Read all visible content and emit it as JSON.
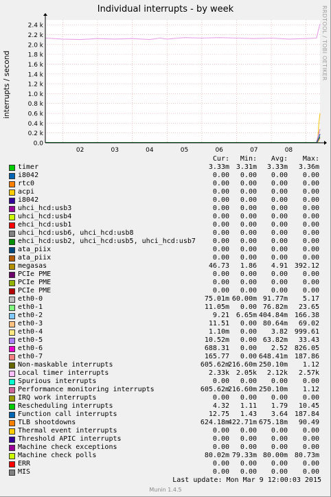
{
  "chart_data": {
    "type": "line",
    "title": "Individual interrupts - by week",
    "ylabel": "interrupts / second",
    "vendor": "RRDTOOL / TOBI OETIKER",
    "ylim": [
      0,
      2.5
    ],
    "yticks": [
      {
        "v": 0.0,
        "label": "0.0"
      },
      {
        "v": 0.2,
        "label": "0.2 k"
      },
      {
        "v": 0.4,
        "label": "0.4 k"
      },
      {
        "v": 0.6,
        "label": "0.6 k"
      },
      {
        "v": 0.8,
        "label": "0.8 k"
      },
      {
        "v": 1.0,
        "label": "1.0 k"
      },
      {
        "v": 1.2,
        "label": "1.2 k"
      },
      {
        "v": 1.4,
        "label": "1.4 k"
      },
      {
        "v": 1.6,
        "label": "1.6 k"
      },
      {
        "v": 1.8,
        "label": "1.8 k"
      },
      {
        "v": 2.0,
        "label": "2.0 k"
      },
      {
        "v": 2.2,
        "label": "2.2 k"
      },
      {
        "v": 2.4,
        "label": "2.4 k"
      }
    ],
    "xlim": [
      1,
      8.9
    ],
    "xticks": [
      {
        "v": 2,
        "label": "02"
      },
      {
        "v": 3,
        "label": "03"
      },
      {
        "v": 4,
        "label": "04"
      },
      {
        "v": 5,
        "label": "05"
      },
      {
        "v": 6,
        "label": "06"
      },
      {
        "v": 7,
        "label": "07"
      },
      {
        "v": 8,
        "label": "08"
      }
    ],
    "grid": true,
    "series": [
      {
        "name": "Local timer interrupts",
        "color": "#e7a0e7",
        "x": [
          1,
          1.5,
          2,
          2.5,
          3,
          3.5,
          4,
          4.3,
          4.5,
          5,
          5.5,
          6,
          6.5,
          7,
          7.5,
          8,
          8.5,
          8.8,
          8.85,
          8.9
        ],
        "y": [
          2.13,
          2.11,
          2.1,
          2.12,
          2.11,
          2.12,
          2.1,
          2.13,
          2.11,
          2.14,
          2.13,
          2.14,
          2.13,
          2.12,
          2.13,
          2.11,
          2.12,
          2.13,
          2.28,
          2.42
        ]
      },
      {
        "name": "acpi",
        "color": "#f2c618",
        "x": [
          1,
          8.8,
          8.84,
          8.87,
          8.9
        ],
        "y": [
          0,
          0,
          0.12,
          0.42,
          0.6
        ]
      },
      {
        "name": "Rescheduling interrupts",
        "color": "#1a9e1a",
        "x": [
          1,
          8.8,
          8.86,
          8.9
        ],
        "y": [
          0.005,
          0.005,
          0.08,
          0.12
        ]
      },
      {
        "name": "eth0-6",
        "color": "#d47ab8",
        "x": [
          1,
          8.8,
          8.87,
          8.9
        ],
        "y": [
          0,
          0,
          0.2,
          0.28
        ]
      },
      {
        "name": "megasas",
        "color": "#cc7a1a",
        "x": [
          1,
          8.8,
          8.86,
          8.9
        ],
        "y": [
          0,
          0,
          0.04,
          0.1
        ]
      },
      {
        "name": "timer",
        "color": "#00cc00",
        "x": [
          1,
          8.9
        ],
        "y": [
          0.003,
          0.003
        ]
      },
      {
        "name": "Function call interrupts",
        "color": "#0b4a9a",
        "x": [
          1,
          8.8,
          8.86,
          8.9
        ],
        "y": [
          0.002,
          0.002,
          0.09,
          0.18
        ]
      },
      {
        "name": "Machine check polls",
        "color": "#000066",
        "x": [
          1,
          8.9
        ],
        "y": [
          0.0,
          0.0
        ]
      }
    ]
  },
  "legend": {
    "headers": [
      "Cur:",
      "Min:",
      "Avg:",
      "Max:"
    ],
    "rows": [
      {
        "name": "timer",
        "color": "#00cc00",
        "cur": "3.33m",
        "min": "3.31m",
        "avg": "3.33m",
        "max": "3.36m"
      },
      {
        "name": "i8042",
        "color": "#0066b3",
        "cur": "0.00",
        "min": "0.00",
        "avg": "0.00",
        "max": "0.00"
      },
      {
        "name": "rtc0",
        "color": "#ff8000",
        "cur": "0.00",
        "min": "0.00",
        "avg": "0.00",
        "max": "0.00"
      },
      {
        "name": "acpi",
        "color": "#ffcc00",
        "cur": "0.00",
        "min": "0.00",
        "avg": "0.00",
        "max": "0.00"
      },
      {
        "name": "i8042",
        "color": "#330099",
        "cur": "0.00",
        "min": "0.00",
        "avg": "0.00",
        "max": "0.00"
      },
      {
        "name": "uhci_hcd:usb3",
        "color": "#990099",
        "cur": "0.00",
        "min": "0.00",
        "avg": "0.00",
        "max": "0.00"
      },
      {
        "name": "uhci_hcd:usb4",
        "color": "#ccff00",
        "cur": "0.00",
        "min": "0.00",
        "avg": "0.00",
        "max": "0.00"
      },
      {
        "name": "ehci_hcd:usb1",
        "color": "#ff0000",
        "cur": "0.00",
        "min": "0.00",
        "avg": "0.00",
        "max": "0.00"
      },
      {
        "name": "uhci_hcd:usb6, uhci_hcd:usb8",
        "color": "#808080",
        "cur": "0.00",
        "min": "0.00",
        "avg": "0.00",
        "max": "0.00"
      },
      {
        "name": "ehci_hcd:usb2, uhci_hcd:usb5, uhci_hcd:usb7",
        "color": "#008f00",
        "cur": "0.00",
        "min": "0.00",
        "avg": "0.00",
        "max": "0.00"
      },
      {
        "name": "ata_piix",
        "color": "#00487d",
        "cur": "0.00",
        "min": "0.00",
        "avg": "0.00",
        "max": "0.00"
      },
      {
        "name": "ata_piix",
        "color": "#b35a00",
        "cur": "0.00",
        "min": "0.00",
        "avg": "0.00",
        "max": "0.00"
      },
      {
        "name": "megasas",
        "color": "#b38f00",
        "cur": "46.73",
        "min": "1.86",
        "avg": "4.91",
        "max": "392.12"
      },
      {
        "name": "PCIe PME",
        "color": "#6b006b",
        "cur": "0.00",
        "min": "0.00",
        "avg": "0.00",
        "max": "0.00"
      },
      {
        "name": "PCIe PME",
        "color": "#8fb300",
        "cur": "0.00",
        "min": "0.00",
        "avg": "0.00",
        "max": "0.00"
      },
      {
        "name": "PCIe PME",
        "color": "#b30000",
        "cur": "0.00",
        "min": "0.00",
        "avg": "0.00",
        "max": "0.00"
      },
      {
        "name": "eth0-0",
        "color": "#bebebe",
        "cur": "75.01m",
        "min": "60.00m",
        "avg": "91.77m",
        "max": "5.17"
      },
      {
        "name": "eth0-1",
        "color": "#80ff80",
        "cur": "11.05m",
        "min": "0.00",
        "avg": "76.82m",
        "max": "23.65"
      },
      {
        "name": "eth0-2",
        "color": "#80c9ff",
        "cur": "9.21",
        "min": "6.65m",
        "avg": "404.84m",
        "max": "166.38"
      },
      {
        "name": "eth0-3",
        "color": "#ffc080",
        "cur": "11.51",
        "min": "0.00",
        "avg": "80.64m",
        "max": "69.02"
      },
      {
        "name": "eth0-4",
        "color": "#ffe680",
        "cur": "1.10m",
        "min": "0.00",
        "avg": "3.82",
        "max": "999.61"
      },
      {
        "name": "eth0-5",
        "color": "#aa80ff",
        "cur": "10.52m",
        "min": "0.00",
        "avg": "63.82m",
        "max": "33.43"
      },
      {
        "name": "eth0-6",
        "color": "#ee00cc",
        "cur": "688.31",
        "min": "0.00",
        "avg": "2.52",
        "max": "826.05"
      },
      {
        "name": "eth0-7",
        "color": "#ff8080",
        "cur": "165.77",
        "min": "0.00",
        "avg": "648.41m",
        "max": "187.86"
      },
      {
        "name": "Non-maskable interrupts",
        "color": "#666600",
        "cur": "605.62m",
        "min": "216.60m",
        "avg": "250.10m",
        "max": "1.12"
      },
      {
        "name": "Local timer interrupts",
        "color": "#ffbfff",
        "cur": "2.33k",
        "min": "2.05k",
        "avg": "2.12k",
        "max": "2.57k"
      },
      {
        "name": "Spurious interrupts",
        "color": "#00ffcc",
        "cur": "0.00",
        "min": "0.00",
        "avg": "0.00",
        "max": "0.00"
      },
      {
        "name": "Performance monitoring interrupts",
        "color": "#cc6699",
        "cur": "605.62m",
        "min": "216.60m",
        "avg": "250.10m",
        "max": "1.12"
      },
      {
        "name": "IRQ work interrupts",
        "color": "#999900",
        "cur": "0.00",
        "min": "0.00",
        "avg": "0.00",
        "max": "0.00"
      },
      {
        "name": "Rescheduling interrupts",
        "color": "#00cc00",
        "cur": "4.32",
        "min": "1.11",
        "avg": "1.79",
        "max": "10.45"
      },
      {
        "name": "Function call interrupts",
        "color": "#0066b3",
        "cur": "12.75",
        "min": "1.43",
        "avg": "3.64",
        "max": "187.84"
      },
      {
        "name": "TLB shootdowns",
        "color": "#ff8000",
        "cur": "624.18m",
        "min": "422.71m",
        "avg": "675.18m",
        "max": "90.49"
      },
      {
        "name": "Thermal event interrupts",
        "color": "#ffcc00",
        "cur": "0.00",
        "min": "0.00",
        "avg": "0.00",
        "max": "0.00"
      },
      {
        "name": "Threshold APIC interrupts",
        "color": "#330099",
        "cur": "0.00",
        "min": "0.00",
        "avg": "0.00",
        "max": "0.00"
      },
      {
        "name": "Machine check exceptions",
        "color": "#990099",
        "cur": "0.00",
        "min": "0.00",
        "avg": "0.00",
        "max": "0.00"
      },
      {
        "name": "Machine check polls",
        "color": "#ccff00",
        "cur": "80.02m",
        "min": "79.33m",
        "avg": "80.00m",
        "max": "80.73m"
      },
      {
        "name": "ERR",
        "color": "#ff0000",
        "cur": "0.00",
        "min": "0.00",
        "avg": "0.00",
        "max": "0.00"
      },
      {
        "name": "MIS",
        "color": "#808080",
        "cur": "0.00",
        "min": "0.00",
        "avg": "0.00",
        "max": "0.00"
      }
    ]
  },
  "footer": {
    "last_update": "Last update:  Mon Mar  9 12:00:03 2015",
    "version": "Munin 1.4.5"
  }
}
